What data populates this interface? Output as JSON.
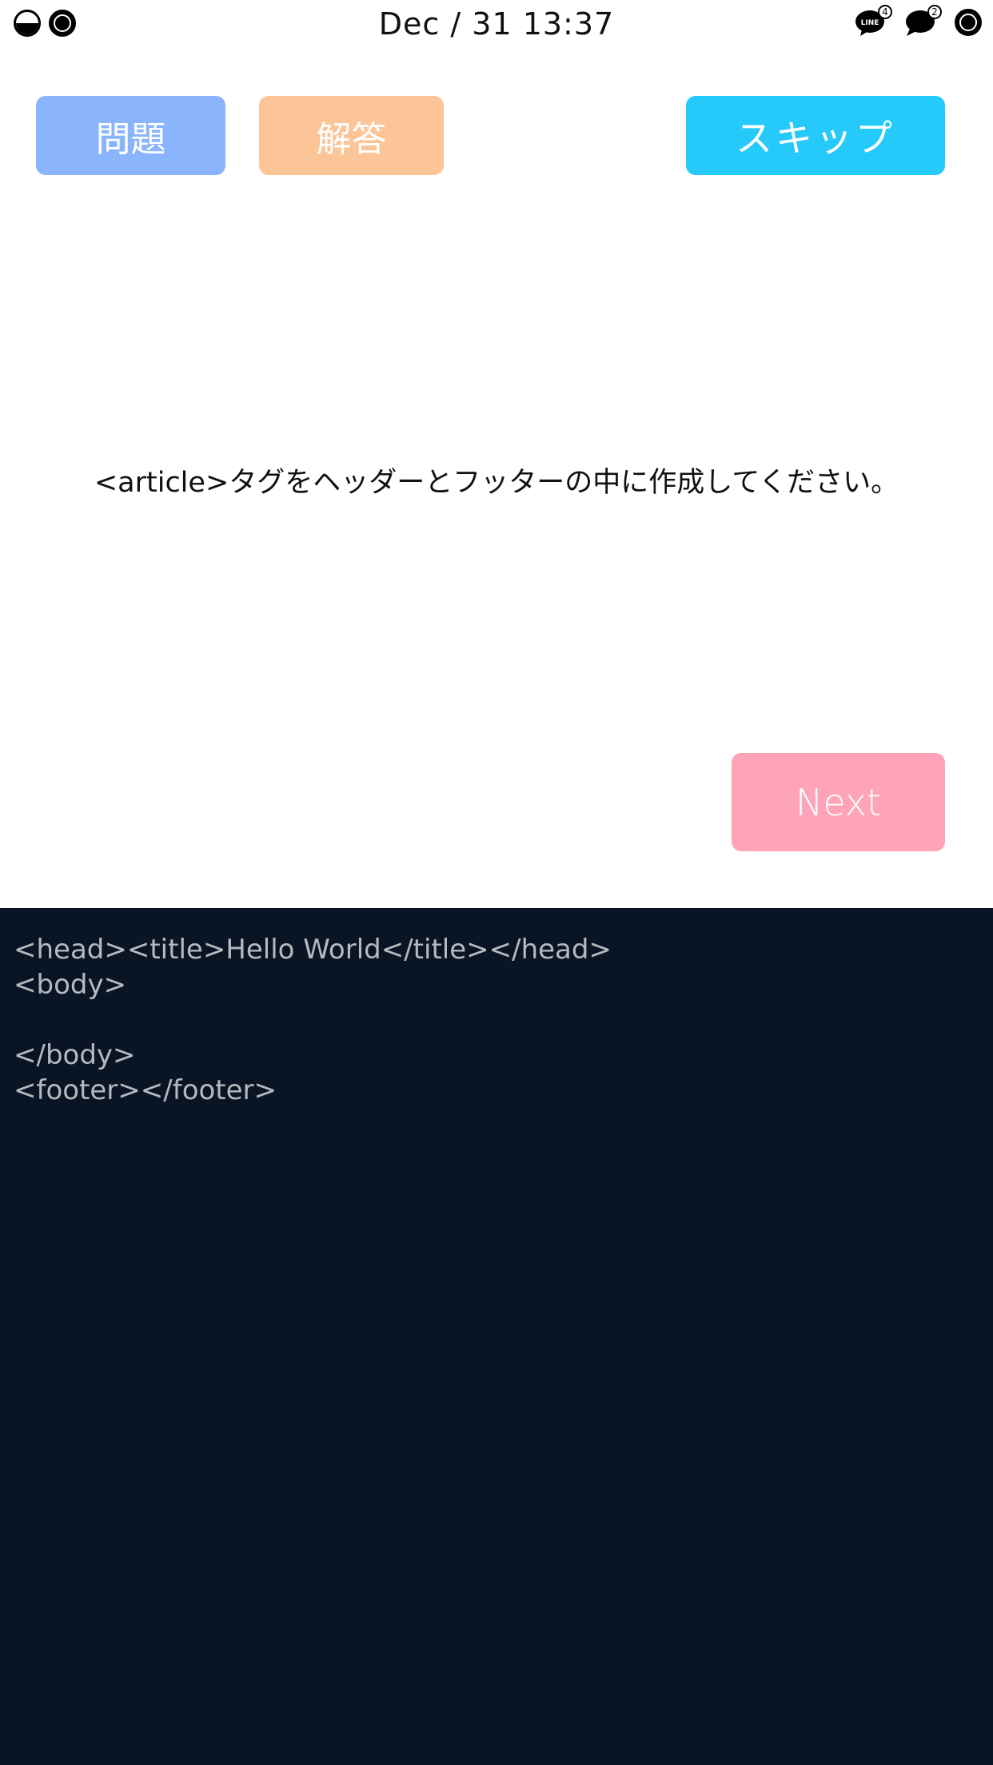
{
  "status_bar": {
    "time": "Dec / 31  13:37",
    "line_badge": "4",
    "chat_badge": "2"
  },
  "toolbar": {
    "question_label": "問題",
    "answer_label": "解答",
    "skip_label": "スキップ"
  },
  "question": {
    "text": "<article>タグをヘッダーとフッターの中に作成してください。"
  },
  "next_label": "Next",
  "editor": {
    "lines": [
      "<head><title>Hello World</title></head>",
      "<body>",
      "",
      "</body>",
      "<footer></footer>"
    ]
  },
  "colors": {
    "question_button": "#8ab4fb",
    "answer_button": "#fcc597",
    "skip_button": "#25cafb",
    "next_button": "#ffa4b8",
    "editor_background": "#091525",
    "code_text": "#b6b9bd"
  },
  "icons": [
    "battery-half-icon",
    "record-icon",
    "line-app-icon",
    "chat-bubble-icon",
    "record-icon"
  ]
}
